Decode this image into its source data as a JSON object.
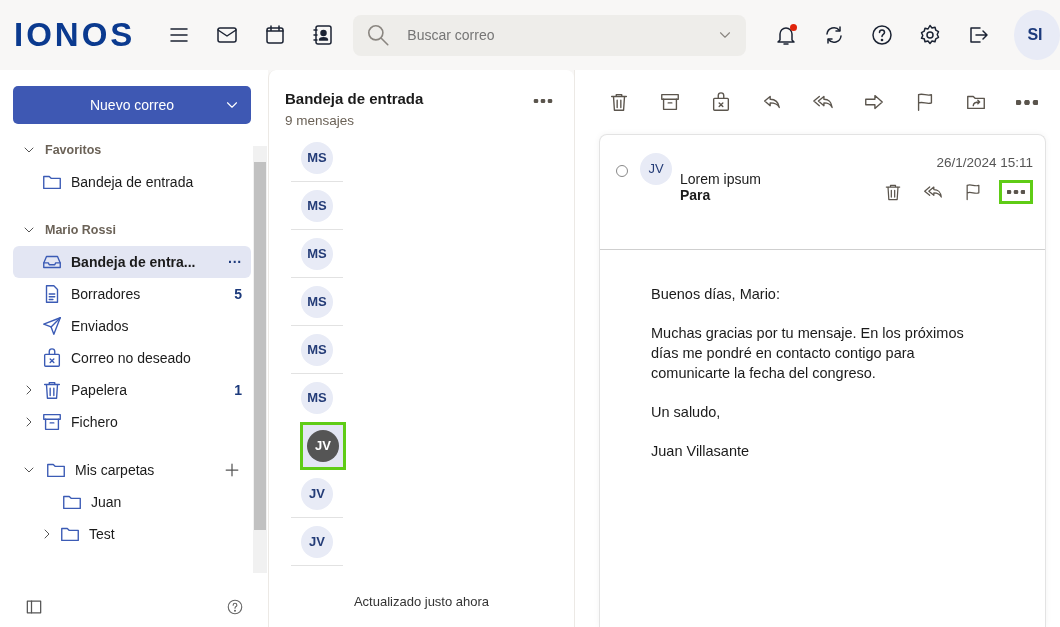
{
  "header": {
    "logo": "IONOS",
    "search": {
      "placeholder": "Buscar correo"
    },
    "notifications": {
      "unread": true
    },
    "avatar": "SI"
  },
  "sidebar": {
    "new_button": "Nuevo correo",
    "sections": [
      {
        "title": "Favoritos",
        "expanded": true,
        "items": [
          {
            "label": "Bandeja de entrada",
            "selected": false
          }
        ]
      },
      {
        "title": "Mario Rossi",
        "expanded": true,
        "items": [
          {
            "label": "Bandeja de entra...",
            "selected": true,
            "menu": "···"
          },
          {
            "label": "Borradores",
            "count": "5",
            "selected": false
          },
          {
            "label": "Enviados",
            "selected": false
          },
          {
            "label": "Correo no deseado",
            "selected": false
          },
          {
            "label": "Papelera",
            "count": "1",
            "expanded": false,
            "selected": false
          },
          {
            "label": "Fichero",
            "expanded": false,
            "selected": false
          }
        ]
      },
      {
        "title": "Mis carpetas",
        "expanded": true,
        "folder": true,
        "items": [
          {
            "label": "Juan",
            "selected": false
          },
          {
            "label": "Test",
            "expanded": false,
            "selected": false
          }
        ]
      }
    ]
  },
  "message_list": {
    "title": "Bandeja de entrada",
    "count": "9 mensajes",
    "messages": [
      {
        "initials": "MS",
        "selected": false,
        "highlighted": false
      },
      {
        "initials": "MS",
        "selected": false,
        "highlighted": false
      },
      {
        "initials": "MS",
        "selected": false,
        "highlighted": false
      },
      {
        "initials": "MS",
        "selected": false,
        "highlighted": false
      },
      {
        "initials": "MS",
        "selected": false,
        "highlighted": false
      },
      {
        "initials": "MS",
        "selected": false,
        "highlighted": false
      },
      {
        "initials": "JV",
        "selected": true,
        "highlighted": true
      },
      {
        "initials": "JV",
        "selected": false,
        "highlighted": false
      },
      {
        "initials": "JV",
        "selected": false,
        "highlighted": false
      }
    ],
    "status": "Actualizado justo ahora"
  },
  "reading_pane": {
    "checked": false,
    "avatar": "JV",
    "sender": "Lorem ipsum",
    "to_label": "Para",
    "date": "26/1/2024 15:11",
    "more_highlighted": true,
    "body": [
      "Buenos días, Mario:",
      "Muchas gracias por tu mensaje. En los próximos días me pondré en contacto contigo para comunicarte la fecha del congreso.",
      "Un saludo,",
      "Juan Villasante"
    ]
  }
}
